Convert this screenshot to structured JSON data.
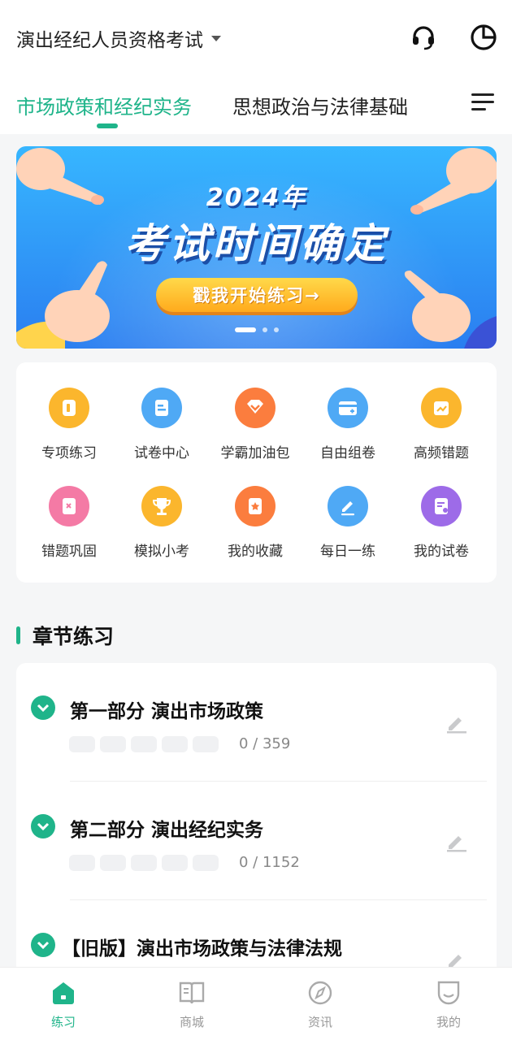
{
  "header": {
    "exam_title": "演出经纪人员资格考试",
    "support_icon": "headset-icon",
    "stats_icon": "pie-chart-icon"
  },
  "subject_tabs": {
    "active": "市场政策和经纪实务",
    "inactive": "思想政治与法律基础",
    "menu_icon": "menu-icon"
  },
  "banner": {
    "year": "2024年",
    "headline": "考试时间确定",
    "cta": "戳我开始练习→",
    "pages": 3,
    "current_page": 1
  },
  "shortcuts": [
    {
      "label": "专项练习",
      "icon": "notebook-icon",
      "color": "#fbb62d"
    },
    {
      "label": "试卷中心",
      "icon": "paper-icon",
      "color": "#4fa9f5"
    },
    {
      "label": "学霸加油包",
      "icon": "gift-icon",
      "color": "#fb7d3e"
    },
    {
      "label": "自由组卷",
      "icon": "wallet-icon",
      "color": "#4fa9f5"
    },
    {
      "label": "高频错题",
      "icon": "trend-icon",
      "color": "#fbb62d"
    },
    {
      "label": "错题巩固",
      "icon": "error-book-icon",
      "color": "#f47aa5"
    },
    {
      "label": "模拟小考",
      "icon": "trophy-icon",
      "color": "#fbb62d"
    },
    {
      "label": "我的收藏",
      "icon": "star-bookmark-icon",
      "color": "#fb7d3e"
    },
    {
      "label": "每日一练",
      "icon": "pencil-icon",
      "color": "#4fa9f5"
    },
    {
      "label": "我的试卷",
      "icon": "my-paper-icon",
      "color": "#9d6be8"
    }
  ],
  "chapter_section": {
    "title": "章节练习",
    "chapters": [
      {
        "title": "第一部分 演出市场政策",
        "progress": "0 / 359"
      },
      {
        "title": "第二部分 演出经纪实务",
        "progress": "0 / 1152"
      },
      {
        "title": "【旧版】演出市场政策与法律法规",
        "progress": ""
      }
    ]
  },
  "bottom_nav": [
    {
      "label": "练习",
      "icon": "home-icon",
      "active": true
    },
    {
      "label": "商城",
      "icon": "book-icon",
      "active": false
    },
    {
      "label": "资讯",
      "icon": "compass-icon",
      "active": false
    },
    {
      "label": "我的",
      "icon": "smile-icon",
      "active": false
    }
  ],
  "colors": {
    "accent": "#1fb48a"
  }
}
